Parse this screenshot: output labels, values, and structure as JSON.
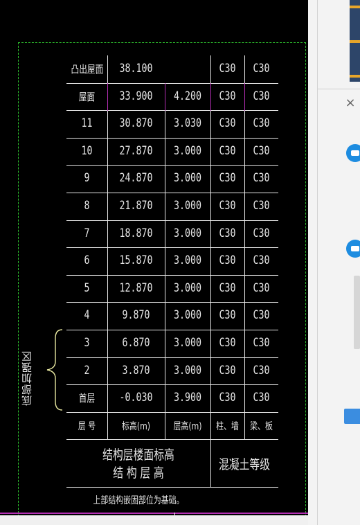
{
  "table": {
    "rows": [
      {
        "floor": "凸出屋面",
        "elev": "38.100",
        "height": "",
        "col": "C30",
        "beam": "C30"
      },
      {
        "floor": "屋面",
        "elev": "33.900",
        "height": "4.200",
        "col": "C30",
        "beam": "C30"
      },
      {
        "floor": "11",
        "elev": "30.870",
        "height": "3.030",
        "col": "C30",
        "beam": "C30"
      },
      {
        "floor": "10",
        "elev": "27.870",
        "height": "3.000",
        "col": "C30",
        "beam": "C30"
      },
      {
        "floor": "9",
        "elev": "24.870",
        "height": "3.000",
        "col": "C30",
        "beam": "C30"
      },
      {
        "floor": "8",
        "elev": "21.870",
        "height": "3.000",
        "col": "C30",
        "beam": "C30"
      },
      {
        "floor": "7",
        "elev": "18.870",
        "height": "3.000",
        "col": "C30",
        "beam": "C30"
      },
      {
        "floor": "6",
        "elev": "15.870",
        "height": "3.000",
        "col": "C30",
        "beam": "C30"
      },
      {
        "floor": "5",
        "elev": "12.870",
        "height": "3.000",
        "col": "C30",
        "beam": "C30"
      },
      {
        "floor": "4",
        "elev": "9.870",
        "height": "3.000",
        "col": "C30",
        "beam": "C30"
      },
      {
        "floor": "3",
        "elev": "6.870",
        "height": "3.000",
        "col": "C30",
        "beam": "C30"
      },
      {
        "floor": "2",
        "elev": "3.870",
        "height": "3.000",
        "col": "C30",
        "beam": "C30"
      },
      {
        "floor": "首层",
        "elev": "-0.030",
        "height": "3.900",
        "col": "C30",
        "beam": "C30"
      }
    ],
    "header": {
      "floor": "层 号",
      "elev": "标高(m)",
      "height": "层高(m)",
      "col": "柱、墙",
      "beam": "梁、板"
    },
    "footer_left_line1": "结构层楼面标高",
    "footer_left_line2": "结 构 层 高",
    "footer_right": "混凝土等级",
    "note": "上部结构嵌固部位为基础。"
  },
  "side_label": "底部加强区",
  "colors": {
    "background": "#000000",
    "lines": "#e8e8e8",
    "highlight": "#b42fb4",
    "border_dash": "#2dbd2d",
    "brace": "#e8e8a0",
    "panel": "#f3f3f3",
    "accent_blue": "#1d8ce0"
  },
  "panel": {
    "close_icon": "×"
  }
}
